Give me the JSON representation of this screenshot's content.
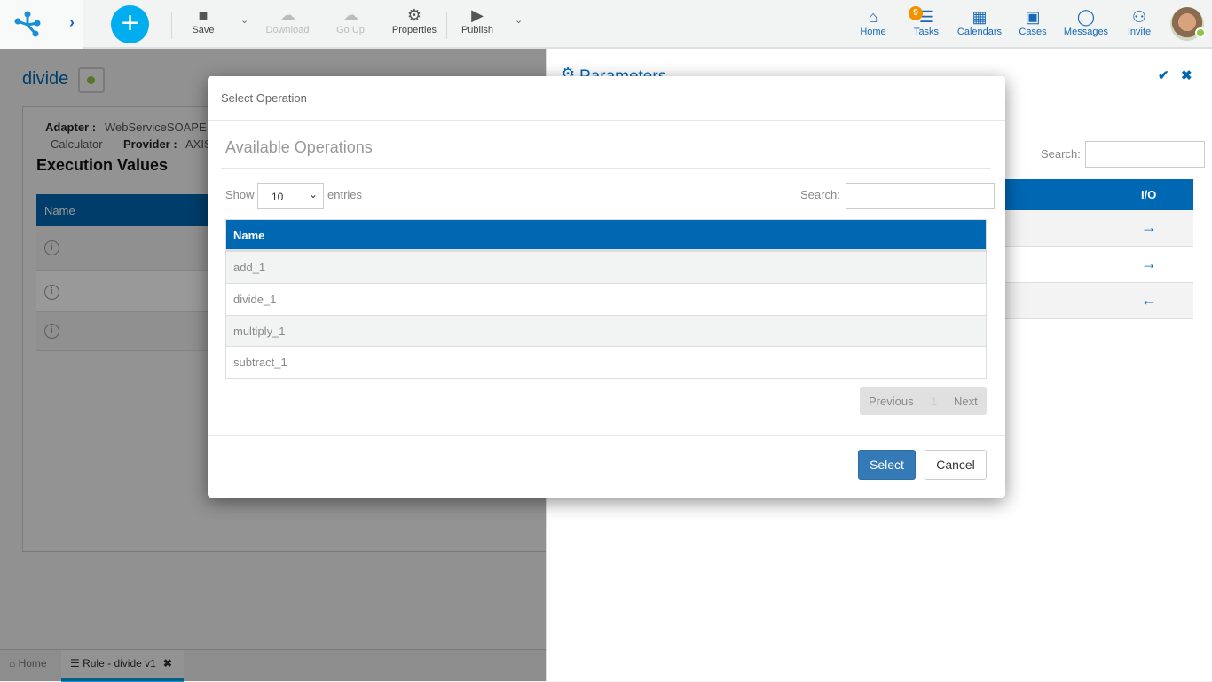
{
  "toolbar": {
    "save": "Save",
    "download": "Download",
    "go_up": "Go Up",
    "properties": "Properties",
    "publish": "Publish"
  },
  "nav": {
    "home": "Home",
    "tasks": "Tasks",
    "tasks_badge": "9",
    "calendars": "Calendars",
    "cases": "Cases",
    "messages": "Messages",
    "invite": "Invite"
  },
  "page": {
    "title": "divide",
    "adapter_label": "Adapter :",
    "adapter_value": "WebServiceSOAPE",
    "calculator": "Calculator",
    "provider_label": "Provider :",
    "provider_value": "AXIS",
    "section": "Execution Values",
    "col_name": "Name"
  },
  "bottom_tabs": [
    {
      "label": "Home"
    },
    {
      "label": "Rule - divide v1"
    }
  ],
  "parameters": {
    "title": "Parameters",
    "search_label": "Search:",
    "search_value": "",
    "col_io": "I/O",
    "rows": [
      {
        "io": "→"
      },
      {
        "io": "→"
      },
      {
        "io": "←"
      }
    ]
  },
  "modal": {
    "title": "Select Operation",
    "heading": "Available Operations",
    "show": "Show",
    "entries": "entries",
    "page_size": "10",
    "search_label": "Search:",
    "search_value": "",
    "col_name": "Name",
    "rows": [
      "add_1",
      "divide_1",
      "multiply_1",
      "subtract_1"
    ],
    "previous": "Previous",
    "page": "1",
    "next": "Next",
    "select": "Select",
    "cancel": "Cancel"
  },
  "colors": {
    "accent": "#0067b3",
    "primary_button": "#337ab7",
    "fab": "#00aeef",
    "badge": "#f39200",
    "status": "#8dc63f"
  }
}
